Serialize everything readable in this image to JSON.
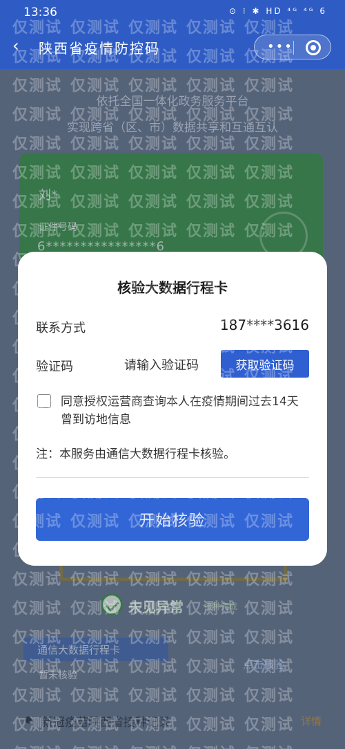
{
  "status_bar": {
    "time": "13:36",
    "icons": "⊙ ⁝ ✱ HD ⁴ᴳ ⁴ᴳ 6"
  },
  "nav": {
    "back_icon": "‹",
    "title": "陕西省疫情防控码",
    "more_icon": "•••"
  },
  "background": {
    "slogan_line1": "依托全国一体化政务服务平台",
    "slogan_line2": "实现跨省（区、市）数据共享和互通互认",
    "name": "刘*",
    "id_label": "证件号码",
    "id_number": "6****************6",
    "result_text": "未见异常",
    "result_sub": "接种完成",
    "strip_text": "通信大数据行程卡",
    "click_verify": "点击核验",
    "unverified": "暂未核验",
    "record_label": "新冠疫苗陕西省接种记录",
    "record_detail": "详情"
  },
  "modal": {
    "title": "核验大数据行程卡",
    "contact_label": "联系方式",
    "phone": "187****3616",
    "code_label": "验证码",
    "code_placeholder": "请输入验证码",
    "get_code_button": "获取验证码",
    "agree_text": "同意授权运营商查询本人在疫情期间过去14天曾到访地信息",
    "note": "注：本服务由通信大数据行程卡核验。",
    "start_button": "开始核验"
  },
  "watermark": {
    "text": "仅测试"
  },
  "colors": {
    "primary_blue": "#2f5fd0",
    "green_card": "#2f8a3c"
  }
}
